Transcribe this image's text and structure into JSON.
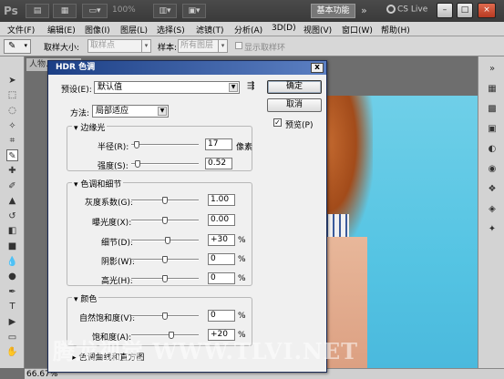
{
  "titlebar": {
    "logo": "Ps",
    "zoom": "100%",
    "workspace": "基本功能",
    "more": "»",
    "cslive": "CS Live",
    "window_buttons": [
      "–",
      "□",
      "×"
    ]
  },
  "menu": [
    "文件(F)",
    "编辑(E)",
    "图像(I)",
    "图层(L)",
    "选择(S)",
    "滤镜(T)",
    "分析(A)",
    "3D(D)",
    "视图(V)",
    "窗口(W)",
    "帮助(H)"
  ],
  "options": {
    "sample_size_label": "取样大小:",
    "sample_size_value": "取样点",
    "sample_label": "样本:",
    "sample_value": "所有图层",
    "show_ring_label": "显示取样环"
  },
  "document": {
    "tab_label": "人物...",
    "zoom_level": "66.67%",
    "watermark": "腾龙视觉 WWW.TLVI.NET"
  },
  "dialog": {
    "title": "HDR 色调",
    "close": "x",
    "preset_label": "预设(E):",
    "preset_value": "默认值",
    "ok": "确定",
    "cancel": "取消",
    "preview_label": "预览(P)",
    "preview_checked": true,
    "method_label": "方法:",
    "method_value": "局部适应",
    "edge_glow": {
      "title": "边缘光",
      "radius_label": "半径(R):",
      "radius_value": "17",
      "radius_unit": "像素",
      "radius_level": 0.04,
      "strength_label": "强度(S):",
      "strength_value": "0.52",
      "strength_level": 0.06
    },
    "tone_detail": {
      "title": "色调和细节",
      "gamma_label": "灰度系数(G):",
      "gamma_value": "1.00",
      "gamma_level": 0.5,
      "exposure_label": "曝光度(X):",
      "exposure_value": "0.00",
      "exposure_level": 0.5,
      "detail_label": "细节(D):",
      "detail_value": "+30",
      "detail_level": 0.54,
      "shadow_label": "阴影(W):",
      "shadow_value": "0",
      "shadow_level": 0.5,
      "highlight_label": "高光(H):",
      "highlight_value": "0",
      "highlight_level": 0.5,
      "percent": "%"
    },
    "color": {
      "title": "颜色",
      "vibrance_label": "自然饱和度(V):",
      "vibrance_value": "0",
      "vibrance_level": 0.5,
      "saturation_label": "饱和度(A):",
      "saturation_value": "+20",
      "saturation_level": 0.6,
      "percent": "%"
    },
    "curve_section": "色调曲线和直方图"
  }
}
